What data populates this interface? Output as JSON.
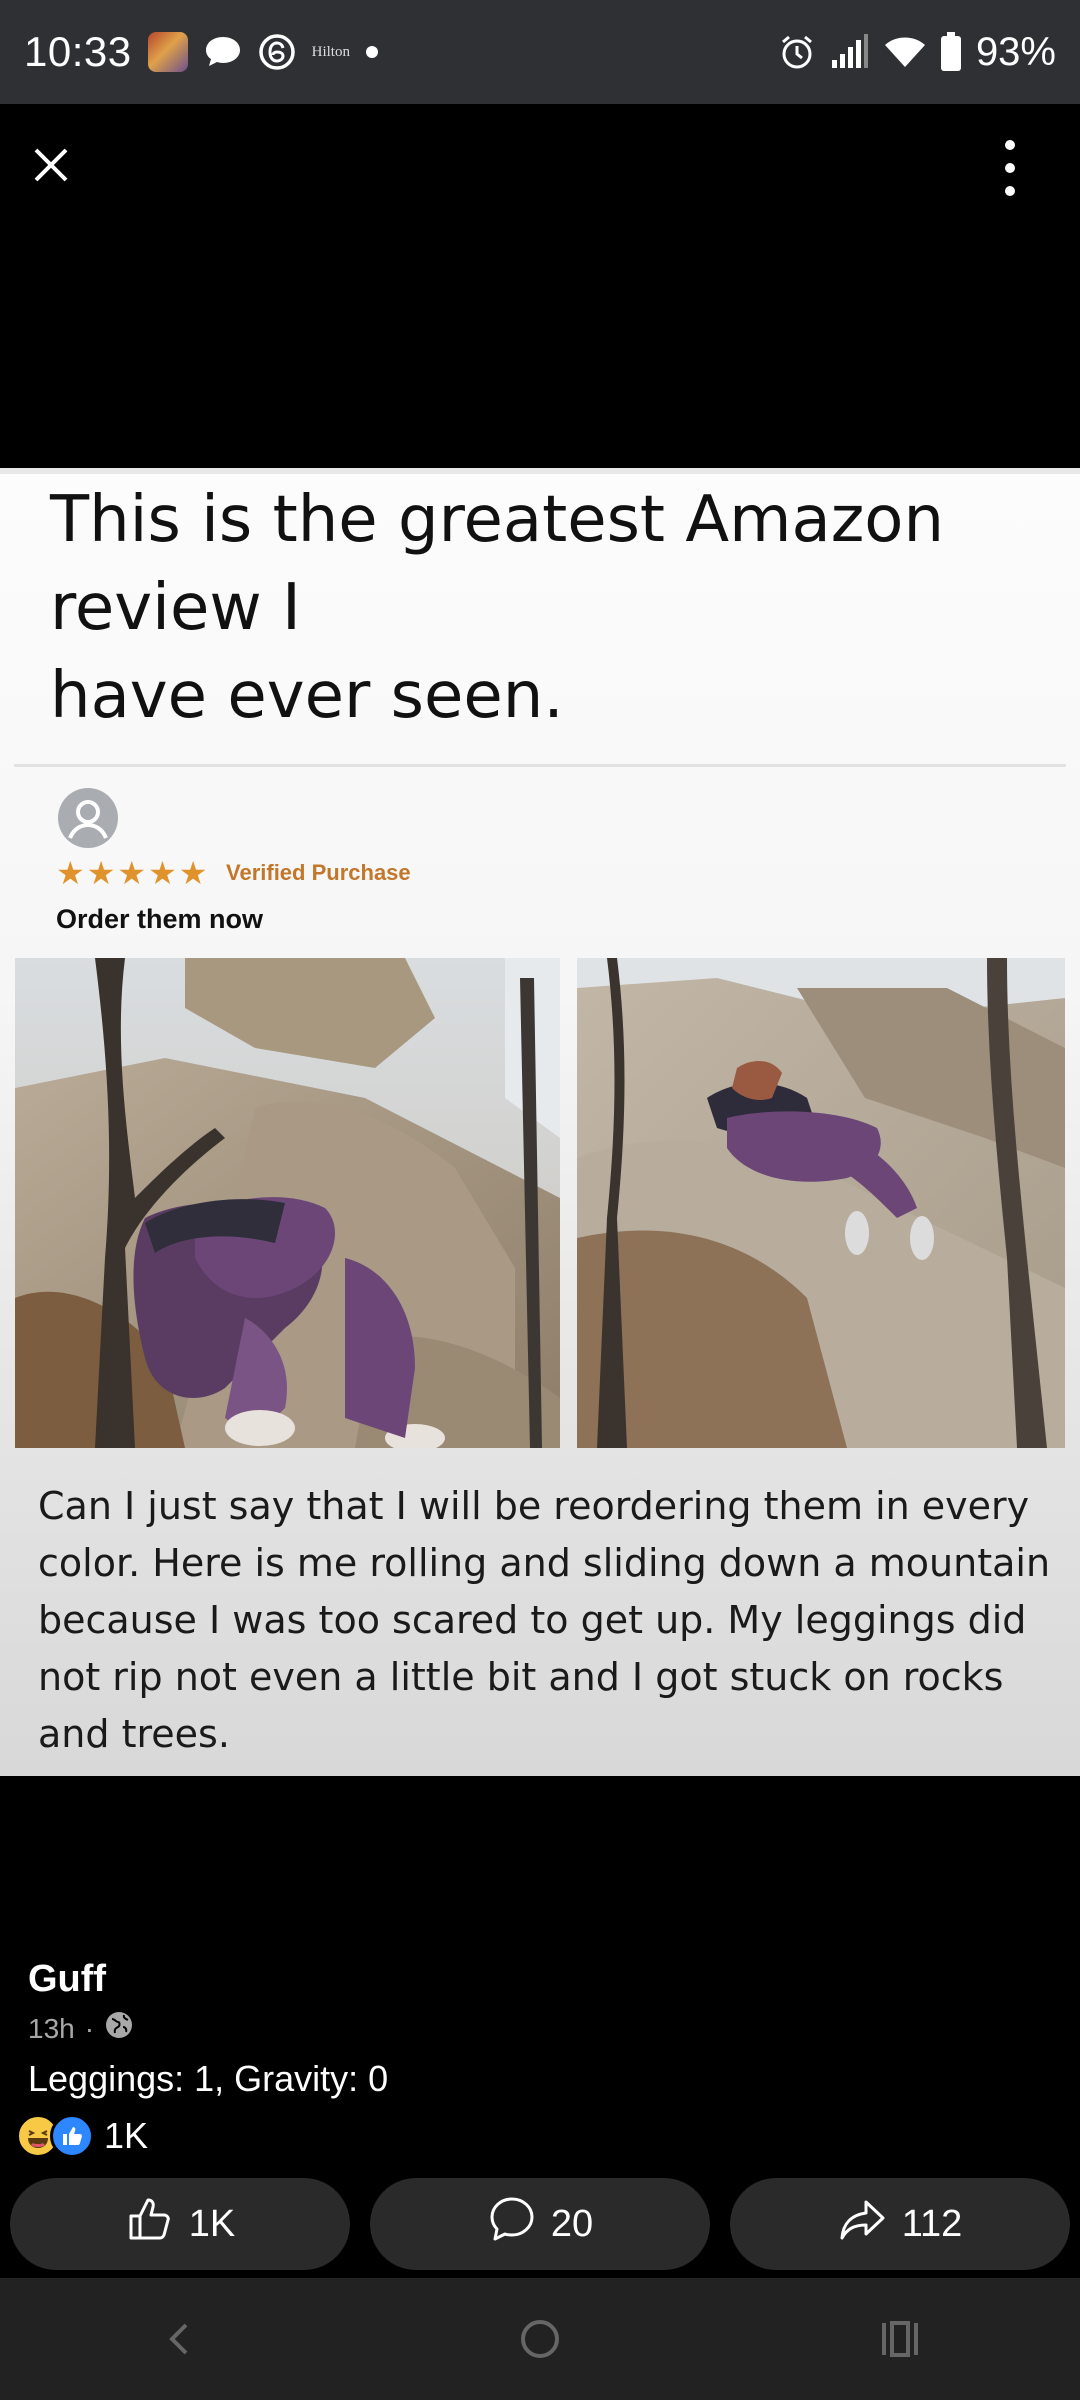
{
  "status_bar": {
    "time": "10:33",
    "hilton_label": "Hilton",
    "battery": "93%",
    "icons": [
      "app-thumbnail-icon",
      "chat-bubble-icon",
      "threads-icon",
      "notification-dot-icon",
      "alarm-icon",
      "signal-icon",
      "wifi-icon",
      "battery-icon"
    ]
  },
  "viewer": {
    "close_icon": "close-icon",
    "more_icon": "more-vertical-icon"
  },
  "post_image": {
    "headline": "This is the greatest Amazon review I\nhave ever seen.",
    "review": {
      "stars": 5,
      "verified_label": "Verified Purchase",
      "title": "Order them now",
      "body": "Can I just say that I will be reordering them in every color. Here is me rolling and sliding down a mountain because I was too scared to get up. My leggings did not rip not even a little bit and I got stuck on rocks and trees."
    },
    "colors": {
      "star": "#e0932c",
      "verified": "#c2772b"
    }
  },
  "post": {
    "author": "Guff",
    "time_ago": "13h",
    "separator": "·",
    "caption": "Leggings: 1, Gravity: 0",
    "reactions_count": "1K",
    "actions": {
      "like_count": "1K",
      "comment_count": "20",
      "share_count": "112"
    }
  },
  "nav_bar": {
    "icons": [
      "back-icon",
      "home-icon",
      "recents-icon"
    ]
  }
}
